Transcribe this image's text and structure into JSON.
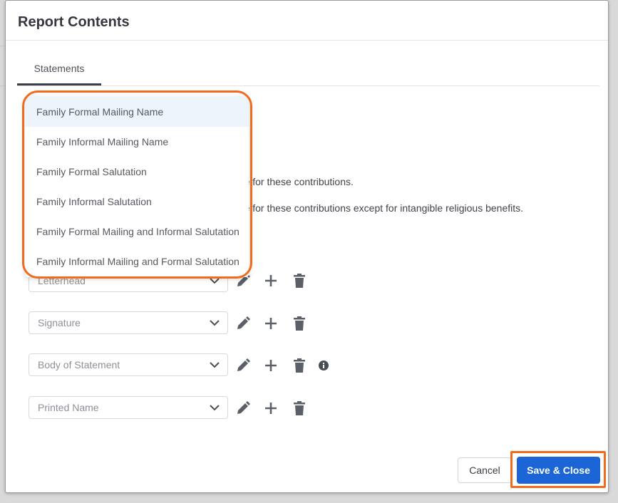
{
  "modal": {
    "title": "Report Contents"
  },
  "tabs": [
    {
      "label": "Statements"
    }
  ],
  "statement_text": {
    "line1": "nge for these contributions.",
    "line2": "nge for these contributions except for intangible religious benefits."
  },
  "dropdown": {
    "items": [
      {
        "label": "Family Formal Mailing Name",
        "active": true
      },
      {
        "label": "Family Informal Mailing Name"
      },
      {
        "label": "Family Formal Salutation"
      },
      {
        "label": "Family Informal Salutation"
      },
      {
        "label": "Family Formal Mailing and Informal Salutation"
      },
      {
        "label": "Family Informal Mailing and Formal Salutation"
      }
    ]
  },
  "sections": [
    {
      "value": "Letterhead"
    },
    {
      "value": "Signature"
    },
    {
      "value": "Body of Statement",
      "info": true
    },
    {
      "value": "Printed Name"
    }
  ],
  "footer": {
    "cancel_label": "Cancel",
    "save_label": "Save & Close"
  },
  "colors": {
    "primary": "#1b65d6",
    "highlight": "#f26b1d",
    "icon": "#5b6068"
  },
  "icons": [
    "pencil-icon",
    "plus-icon",
    "trash-icon",
    "chevron-down-icon",
    "info-icon"
  ]
}
